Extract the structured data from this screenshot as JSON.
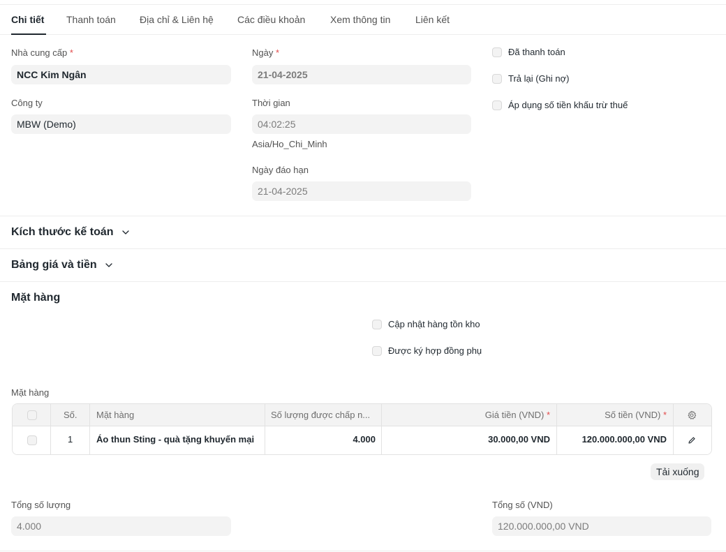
{
  "tabs": [
    {
      "label": "Chi tiết"
    },
    {
      "label": "Thanh toán"
    },
    {
      "label": "Địa chỉ & Liên hệ"
    },
    {
      "label": "Các điều khoản"
    },
    {
      "label": "Xem thông tin"
    },
    {
      "label": "Liên kết"
    }
  ],
  "details": {
    "supplier_label": "Nhà cung cấp",
    "supplier_value": "NCC Kim Ngân",
    "company_label": "Công ty",
    "company_value": "MBW (Demo)",
    "date_label": "Ngày",
    "date_value": "21-04-2025",
    "time_label": "Thời gian",
    "time_value": "04:02:25",
    "timezone": "Asia/Ho_Chi_Minh",
    "due_label": "Ngày đáo hạn",
    "due_value": "21-04-2025",
    "required_mark": "*",
    "checks": [
      {
        "label": "Đã thanh toán",
        "checked": false
      },
      {
        "label": "Trả lại (Ghi nợ)",
        "checked": false
      },
      {
        "label": "Áp dụng số tiền khấu trừ thuế",
        "checked": false
      }
    ]
  },
  "sections": {
    "accounting": "Kích thước kế toán",
    "price_list": "Bảng giá và tiền",
    "items": "Mặt hàng"
  },
  "items_section": {
    "update_stock": "Cập nhật hàng tồn kho",
    "subcontracted": "Được ký hợp đồng phụ",
    "table_label": "Mặt hàng",
    "headers": {
      "no": "Số.",
      "item": "Mặt hàng",
      "accepted_qty": "Số lượng được chấp n...",
      "rate": "Giá tiền (VND)",
      "amount": "Số tiền (VND)"
    },
    "rows": [
      {
        "no": "1",
        "item": "Áo thun Sting - quà tặng khuyến mại",
        "accepted_qty": "4.000",
        "rate": "30.000,00 VND",
        "amount": "120.000.000,00 VND"
      }
    ],
    "download_button": "Tải xuống"
  },
  "totals": {
    "qty_label": "Tổng số lượng",
    "qty_value": "4.000",
    "total_label": "Tổng số (VND)",
    "total_value": "120.000.000,00 VND"
  },
  "colors": {
    "required": "#e24c4c",
    "field_bg": "#f3f3f3",
    "text": "#1f272e"
  }
}
